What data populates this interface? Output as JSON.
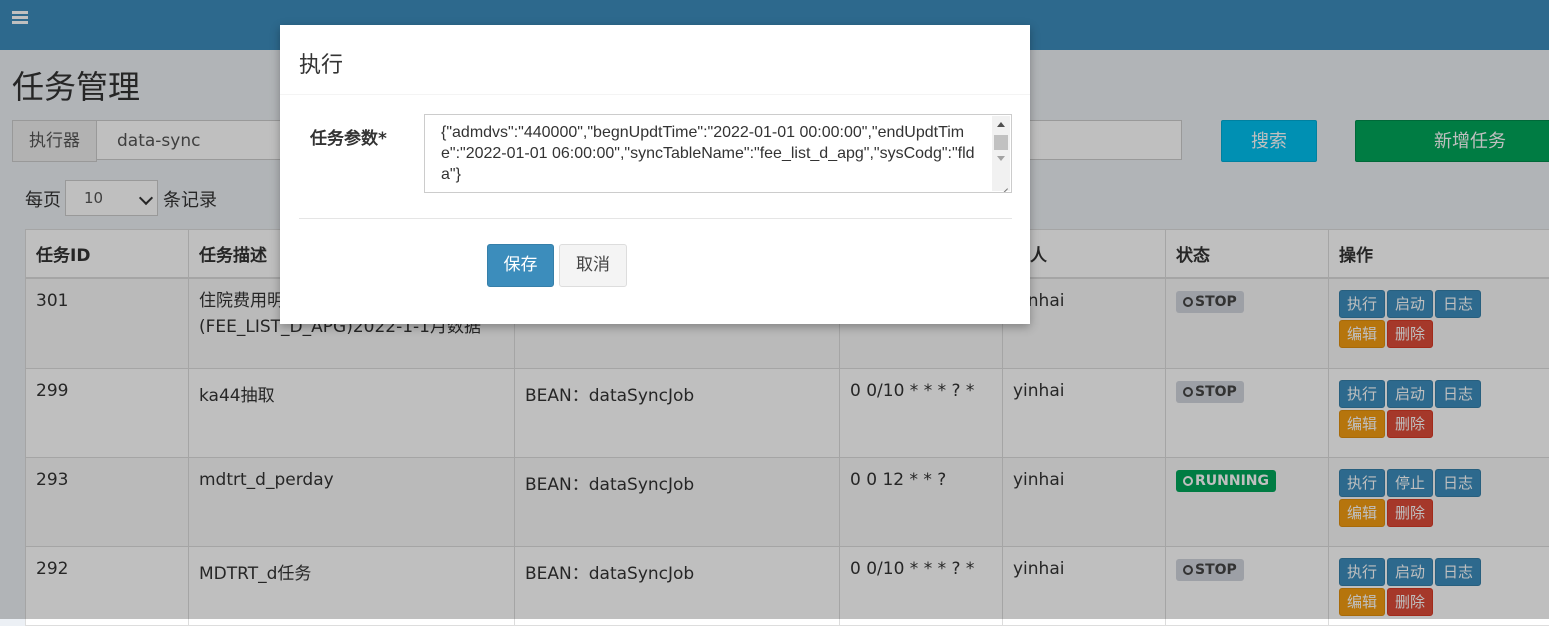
{
  "header": {
    "menu_icon": "hamburger-icon"
  },
  "page": {
    "title": "任务管理"
  },
  "search": {
    "addon_label": "执行器",
    "value": "data-sync",
    "search_label": "搜索",
    "add_label": "新增任务"
  },
  "length": {
    "prefix": "每页",
    "value": "10",
    "suffix": "条记录"
  },
  "table": {
    "headers": [
      "任务ID",
      "任务描述",
      "",
      "",
      "责人",
      "状态",
      "操作"
    ],
    "rows": [
      {
        "id": "301",
        "desc": "住院费用明\n(FEE_LIST_D_APG)2022-1-1月数据",
        "handler": "",
        "cron": "",
        "owner": "yinhai",
        "status": "STOP",
        "ops": [
          "执行",
          "启动",
          "日志",
          "编辑",
          "删除"
        ]
      },
      {
        "id": "299",
        "desc": "ka44抽取",
        "handler": "BEAN：dataSyncJob",
        "cron": "0 0/10 * * * ? *",
        "owner": "yinhai",
        "status": "STOP",
        "ops": [
          "执行",
          "启动",
          "日志",
          "编辑",
          "删除"
        ]
      },
      {
        "id": "293",
        "desc": "mdtrt_d_perday",
        "handler": "BEAN：dataSyncJob",
        "cron": "0 0 12 * * ?",
        "owner": "yinhai",
        "status": "RUNNING",
        "ops": [
          "执行",
          "停止",
          "日志",
          "编辑",
          "删除"
        ]
      },
      {
        "id": "292",
        "desc": "MDTRT_d任务",
        "handler": "BEAN：dataSyncJob",
        "cron": "0 0/10 * * * ? *",
        "owner": "yinhai",
        "status": "STOP",
        "ops": [
          "执行",
          "启动",
          "日志",
          "编辑",
          "删除"
        ]
      }
    ]
  },
  "modal": {
    "title": "执行",
    "param_label": "任务参数*",
    "param_value": "{\"admdvs\":\"440000\",\"begnUpdtTime\":\"2022-01-01 00:00:00\",\"endUpdtTime\":\"2022-01-01 06:00:00\",\"syncTableName\":\"fee_list_d_apg\",\"sysCodg\":\"flda\"}",
    "save_label": "保存",
    "cancel_label": "取消"
  },
  "colors": {
    "header": "#3c8dbc",
    "info": "#00c0ef",
    "success": "#00a65a",
    "warning": "#f39c12",
    "danger": "#dd4b39"
  }
}
